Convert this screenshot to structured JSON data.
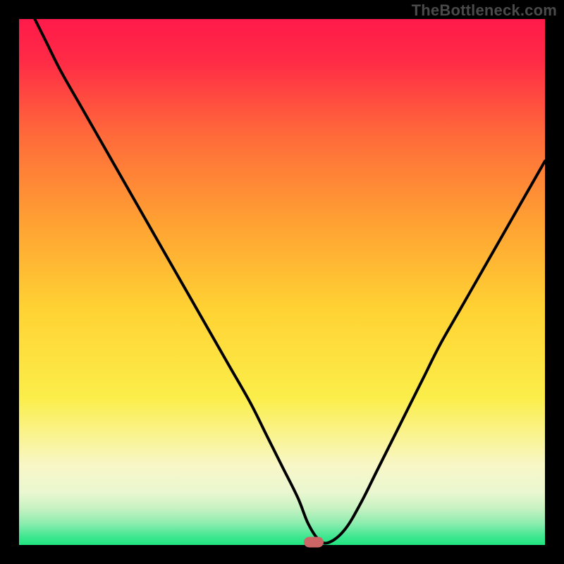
{
  "watermark": "TheBottleneck.com",
  "colors": {
    "background": "#000000",
    "gradient_top": "#ff1a4a",
    "gradient_mid": "#ffd233",
    "gradient_low": "#f8f7c8",
    "gradient_bottom": "#1fe57f",
    "curve": "#000000",
    "marker": "#cc6666"
  },
  "chart_data": {
    "type": "line",
    "title": "",
    "xlabel": "",
    "ylabel": "",
    "xlim": [
      0,
      100
    ],
    "ylim": [
      0,
      100
    ],
    "grid": false,
    "legend": false,
    "marker": {
      "x": 56,
      "y": 0.5
    },
    "series": [
      {
        "name": "bottleneck-curve",
        "x": [
          3,
          5,
          8,
          12,
          16,
          20,
          24,
          28,
          32,
          36,
          40,
          44,
          47,
          50,
          53,
          55,
          57,
          59,
          62,
          65,
          68,
          71,
          74,
          77,
          80,
          84,
          88,
          92,
          96,
          100
        ],
        "y": [
          100,
          96,
          90,
          83,
          76,
          69,
          62,
          55,
          48,
          41,
          34,
          27,
          21,
          15,
          9,
          4,
          1,
          0.5,
          3,
          8,
          14,
          20,
          26,
          32,
          38,
          45,
          52,
          59,
          66,
          73
        ]
      }
    ]
  }
}
